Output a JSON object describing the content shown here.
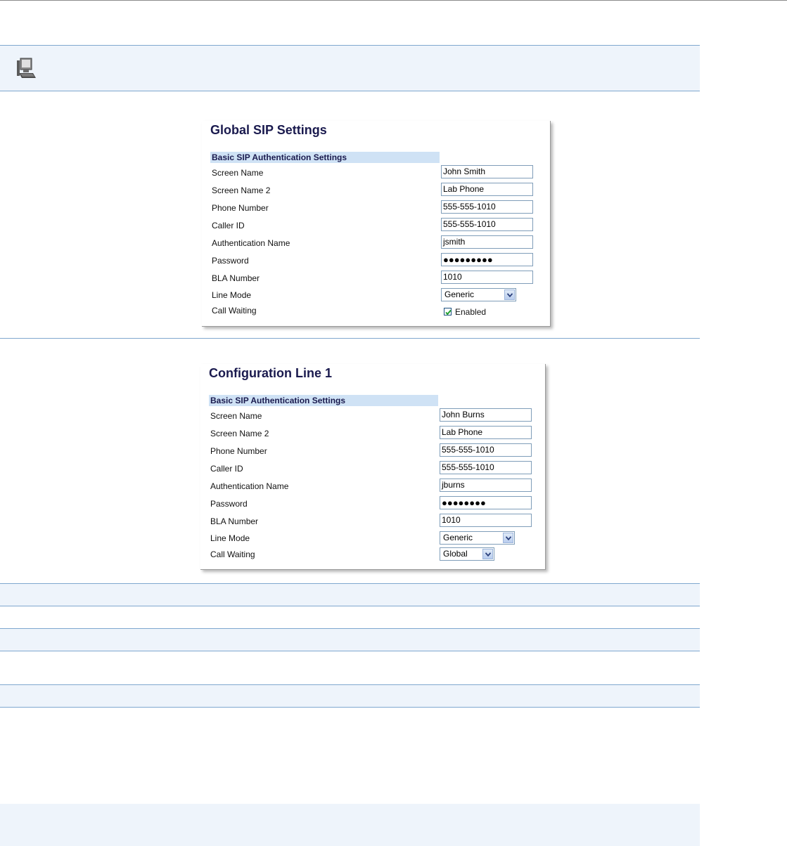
{
  "global": {
    "title": "Global SIP Settings",
    "section": "Basic SIP Authentication Settings",
    "rows": [
      {
        "label": "Screen Name",
        "value": "John Smith"
      },
      {
        "label": "Screen Name 2",
        "value": "Lab Phone"
      },
      {
        "label": "Phone Number",
        "value": "555-555-1010"
      },
      {
        "label": "Caller ID",
        "value": "555-555-1010"
      },
      {
        "label": "Authentication Name",
        "value": "jsmith"
      },
      {
        "label": "Password",
        "value": "●●●●●●●●●"
      },
      {
        "label": "BLA Number",
        "value": "1010"
      },
      {
        "label": "Line Mode",
        "value": "Generic"
      },
      {
        "label": "Call Waiting",
        "value": "Enabled",
        "checked": true
      }
    ]
  },
  "line1": {
    "title": "Configuration Line 1",
    "section": "Basic SIP Authentication Settings",
    "rows": [
      {
        "label": "Screen Name",
        "value": "John Burns"
      },
      {
        "label": "Screen Name 2",
        "value": "Lab Phone"
      },
      {
        "label": "Phone Number",
        "value": "555-555-1010"
      },
      {
        "label": "Caller ID",
        "value": "555-555-1010"
      },
      {
        "label": "Authentication Name",
        "value": "jburns"
      },
      {
        "label": "Password",
        "value": "●●●●●●●●"
      },
      {
        "label": "BLA Number",
        "value": "1010"
      },
      {
        "label": "Line Mode",
        "value": "Generic"
      },
      {
        "label": "Call Waiting",
        "value": "Global"
      }
    ]
  },
  "icons": {
    "header": "computer-icon"
  },
  "colors": {
    "rule": "#7fa7cf",
    "band": "#eef4fb",
    "title": "#1a1a4e",
    "section_bg": "#cfe2f5"
  }
}
